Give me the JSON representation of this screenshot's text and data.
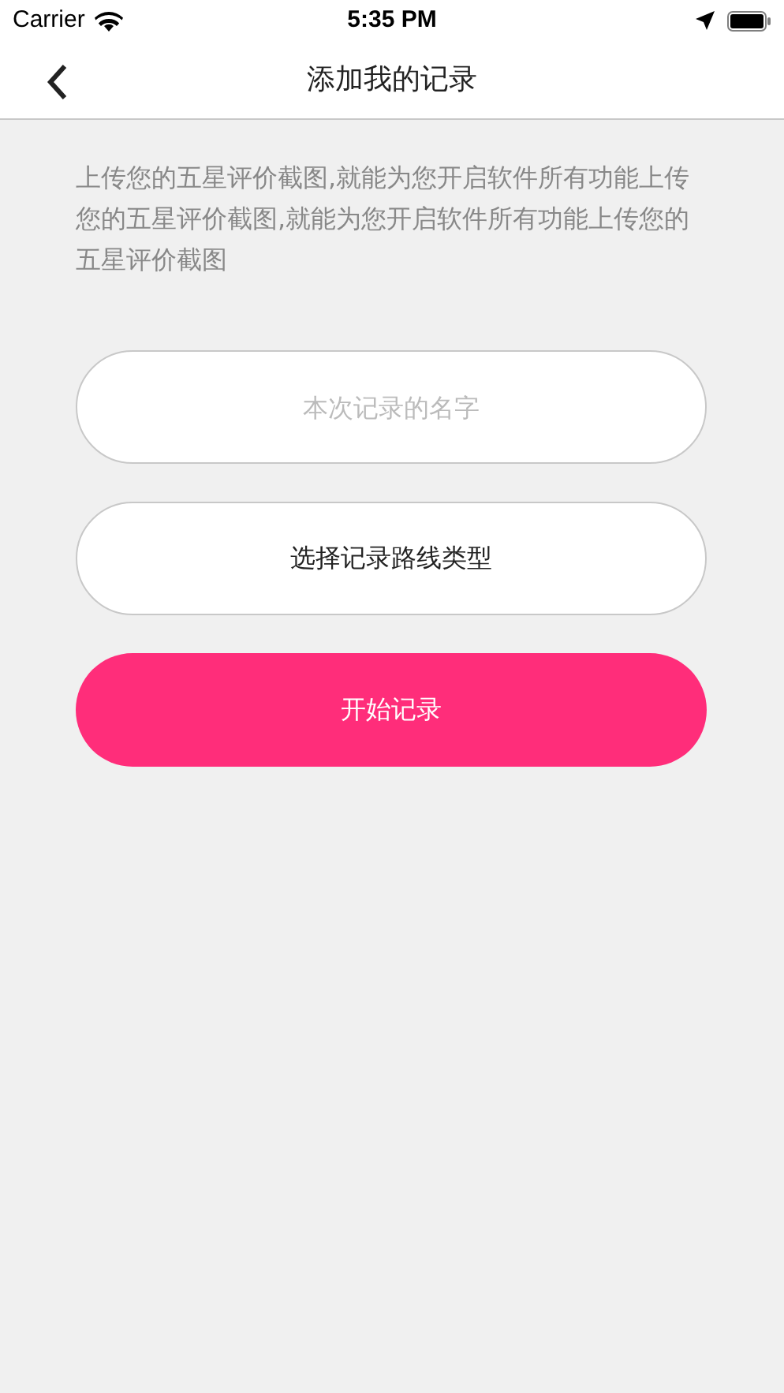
{
  "status_bar": {
    "carrier": "Carrier",
    "time": "5:35 PM"
  },
  "nav": {
    "title": "添加我的记录"
  },
  "intro": "上传您的五星评价截图,就能为您开启软件所有功能上传您的五星评价截图,就能为您开启软件所有功能上传您的五星评价截图",
  "name_field": {
    "placeholder": "本次记录的名字"
  },
  "route_type_button": {
    "label": "选择记录路线类型"
  },
  "start_button": {
    "label": "开始记录"
  }
}
